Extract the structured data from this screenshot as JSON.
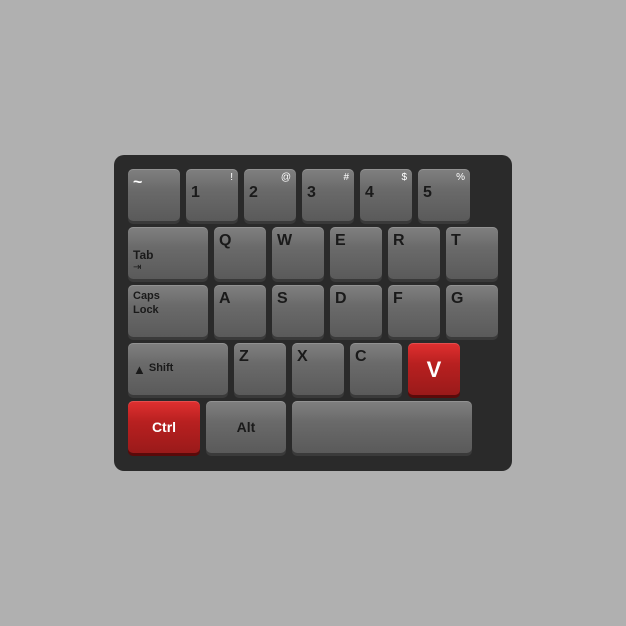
{
  "keyboard": {
    "rows": [
      {
        "id": "row1",
        "keys": [
          {
            "id": "tilde",
            "top": "",
            "main": "~",
            "label": "",
            "type": "normal",
            "color": "dark"
          },
          {
            "id": "1",
            "top": "!",
            "main": "1",
            "label": "",
            "type": "dual",
            "color": "normal"
          },
          {
            "id": "2",
            "top": "@",
            "main": "2",
            "label": "",
            "type": "dual",
            "color": "normal"
          },
          {
            "id": "3",
            "top": "#",
            "main": "3",
            "label": "",
            "type": "dual",
            "color": "normal"
          },
          {
            "id": "4",
            "top": "$",
            "main": "4",
            "label": "",
            "type": "dual",
            "color": "normal"
          },
          {
            "id": "5",
            "top": "%",
            "main": "5",
            "label": "",
            "type": "dual",
            "color": "normal"
          }
        ]
      },
      {
        "id": "row2",
        "keys": [
          {
            "id": "tab",
            "top": "",
            "main": "Tab",
            "label": "Tab",
            "type": "wide-tab",
            "color": "normal"
          },
          {
            "id": "q",
            "top": "",
            "main": "Q",
            "label": "",
            "type": "normal",
            "color": "normal"
          },
          {
            "id": "w",
            "top": "",
            "main": "W",
            "label": "",
            "type": "normal",
            "color": "normal"
          },
          {
            "id": "e",
            "top": "",
            "main": "E",
            "label": "",
            "type": "normal",
            "color": "normal"
          },
          {
            "id": "r",
            "top": "",
            "main": "R",
            "label": "",
            "type": "normal",
            "color": "normal"
          },
          {
            "id": "t",
            "top": "",
            "main": "T",
            "label": "",
            "type": "normal",
            "color": "normal"
          }
        ]
      },
      {
        "id": "row3",
        "keys": [
          {
            "id": "caps",
            "top": "",
            "main": "Caps Lock",
            "label": "Caps\nLock",
            "type": "wide-caps",
            "color": "normal"
          },
          {
            "id": "a",
            "top": "",
            "main": "A",
            "label": "",
            "type": "normal",
            "color": "normal"
          },
          {
            "id": "s",
            "top": "",
            "main": "S",
            "label": "",
            "type": "normal",
            "color": "normal"
          },
          {
            "id": "d",
            "top": "",
            "main": "D",
            "label": "",
            "type": "normal",
            "color": "normal"
          },
          {
            "id": "f",
            "top": "",
            "main": "F",
            "label": "",
            "type": "normal",
            "color": "normal"
          },
          {
            "id": "g",
            "top": "",
            "main": "G",
            "label": "",
            "type": "normal",
            "color": "normal"
          }
        ]
      },
      {
        "id": "row4",
        "keys": [
          {
            "id": "shift",
            "top": "",
            "main": "Shift",
            "label": "▲Shift",
            "type": "wide-shift",
            "color": "normal"
          },
          {
            "id": "z",
            "top": "",
            "main": "Z",
            "label": "",
            "type": "normal",
            "color": "normal"
          },
          {
            "id": "x",
            "top": "",
            "main": "X",
            "label": "",
            "type": "normal",
            "color": "normal"
          },
          {
            "id": "c",
            "top": "",
            "main": "C",
            "label": "",
            "type": "normal",
            "color": "normal"
          },
          {
            "id": "v",
            "top": "",
            "main": "V",
            "label": "",
            "type": "normal",
            "color": "red"
          }
        ]
      },
      {
        "id": "row5",
        "keys": [
          {
            "id": "ctrl",
            "top": "",
            "main": "Ctrl",
            "label": "Ctrl",
            "type": "wide-ctrl",
            "color": "red"
          },
          {
            "id": "alt",
            "top": "",
            "main": "Alt",
            "label": "Alt",
            "type": "wide-alt",
            "color": "normal"
          },
          {
            "id": "space",
            "top": "",
            "main": "",
            "label": "",
            "type": "wide-space",
            "color": "normal"
          }
        ]
      }
    ]
  }
}
